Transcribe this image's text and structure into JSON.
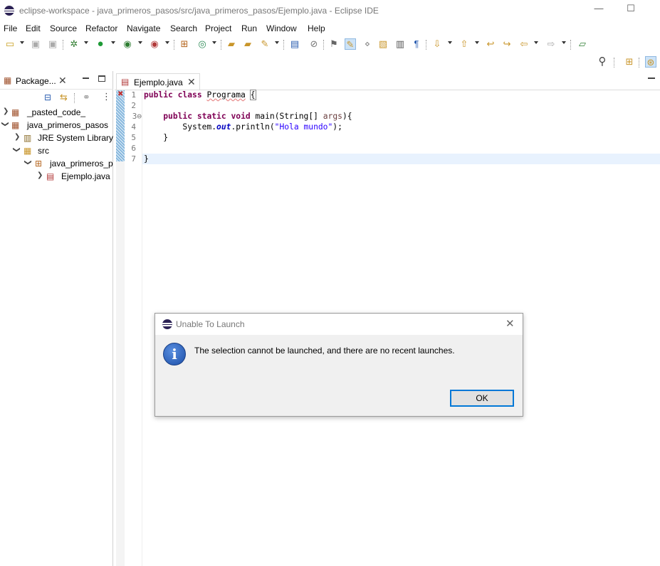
{
  "window": {
    "title": "eclipse-workspace - java_primeros_pasos/src/java_primeros_pasos/Ejemplo.java - Eclipse IDE",
    "minimize": "—",
    "maximize": "☐"
  },
  "menu": [
    "File",
    "Edit",
    "Source",
    "Refactor",
    "Navigate",
    "Search",
    "Project",
    "Run",
    "Window",
    "Help"
  ],
  "package_explorer": {
    "tab_label": "Package...",
    "tree": [
      {
        "label": "_pasted_code_",
        "depth": 0,
        "expanded": false
      },
      {
        "label": "java_primeros_pasos",
        "depth": 0,
        "expanded": true
      },
      {
        "label": "JRE System Library [",
        "depth": 1,
        "expanded": false
      },
      {
        "label": "src",
        "depth": 1,
        "expanded": true
      },
      {
        "label": "java_primeros_pa",
        "depth": 2,
        "expanded": true
      },
      {
        "label": "Ejemplo.java",
        "depth": 3,
        "expanded": false
      }
    ]
  },
  "editor": {
    "tab_label": "Ejemplo.java",
    "line_numbers": [
      "1",
      "2",
      "3⊖",
      "4",
      "5",
      "6",
      "7"
    ]
  },
  "dialog": {
    "title": "Unable To Launch",
    "message": "The selection cannot be launched, and there are no recent launches.",
    "ok_label": "OK"
  },
  "colors": {
    "keyword": "#7f0055",
    "string": "#2a00ff",
    "field": "#0000c0",
    "accent": "#0078d7"
  }
}
